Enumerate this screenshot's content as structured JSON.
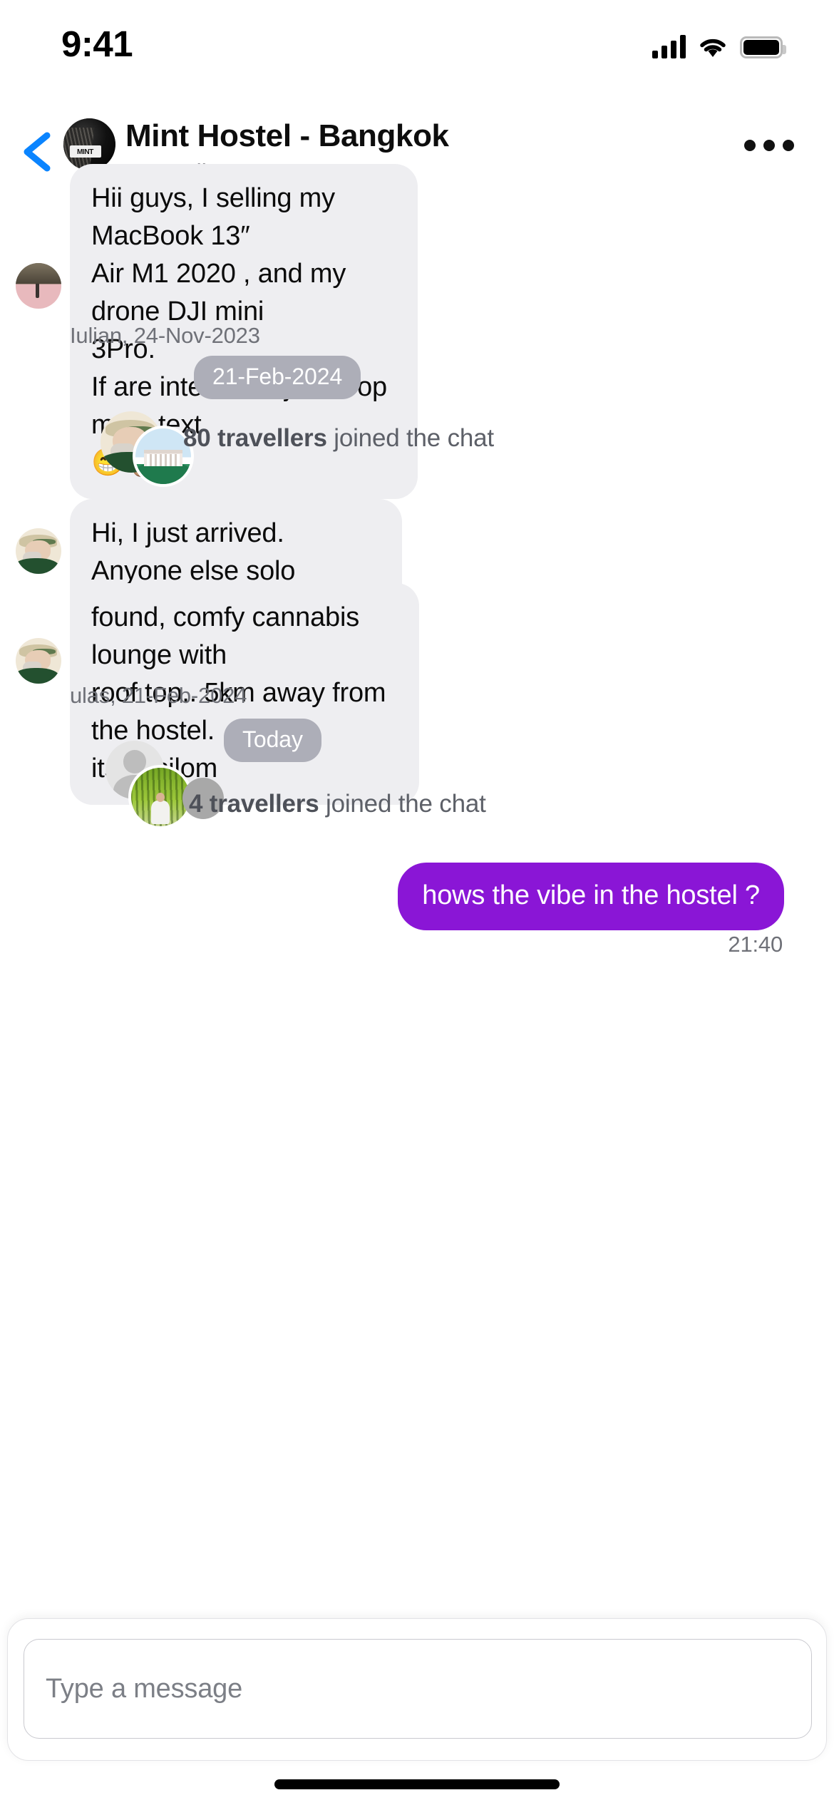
{
  "status_bar": {
    "time": "9:41",
    "signal_icon": "cellular-signal-icon",
    "wifi_icon": "wifi-icon",
    "battery_icon": "battery-icon"
  },
  "nav": {
    "back_icon": "back-chevron-icon",
    "avatar_icon": "group-avatar",
    "avatar_text": "MINT",
    "title": "Mint Hostel - Bangkok",
    "subtitle": "4 travellers",
    "more_icon": "more-options-icon"
  },
  "accent_colors": {
    "back_chevron": "#0a84ff",
    "outgoing_bubble": "#8a16d6",
    "incoming_bubble": "#eeeef1",
    "date_chip": "#adaeb8",
    "meta_text": "#6f7178"
  },
  "messages": [
    {
      "id": "msg-1",
      "type": "incoming",
      "avatar": "avatar-beach-traveller",
      "text": "Hii  guys, I selling my MacBook 13″\nAir M1 2020 , and my drone DJI mini\n3Pro.\nIf are interested just drop me a text\n😁✌🏽",
      "meta": "Iulian, 24-Nov-2023"
    },
    {
      "id": "divider-1",
      "type": "date_divider",
      "label": "21-Feb-2024"
    },
    {
      "id": "join-1",
      "type": "system_join",
      "count_label": "80 travellers",
      "suffix": " joined the chat",
      "avatars": [
        "avatar-capped-man",
        "avatar-temple"
      ]
    },
    {
      "id": "msg-2",
      "type": "incoming",
      "avatar": "avatar-capped-man",
      "text": "Hi, I just arrived. Anyone else solo\ntravelling?"
    },
    {
      "id": "msg-3",
      "type": "incoming",
      "avatar": "avatar-capped-man",
      "text": "found, comfy cannabis lounge with\nroof top.. 5km away from the hostel.\nits at silom",
      "meta": "ulas, 21-Feb-2024"
    },
    {
      "id": "divider-2",
      "type": "date_divider",
      "label": "Today"
    },
    {
      "id": "join-2",
      "type": "system_join",
      "count_label": "4 travellers",
      "suffix": " joined the chat",
      "avatars": [
        "avatar-placeholder-person",
        "avatar-forest-man",
        "avatar-gray-circle"
      ]
    },
    {
      "id": "msg-4",
      "type": "outgoing",
      "text": "hows the vibe in the hostel ?",
      "meta": "21:40"
    }
  ],
  "composer": {
    "placeholder": "Type a message",
    "value": ""
  }
}
